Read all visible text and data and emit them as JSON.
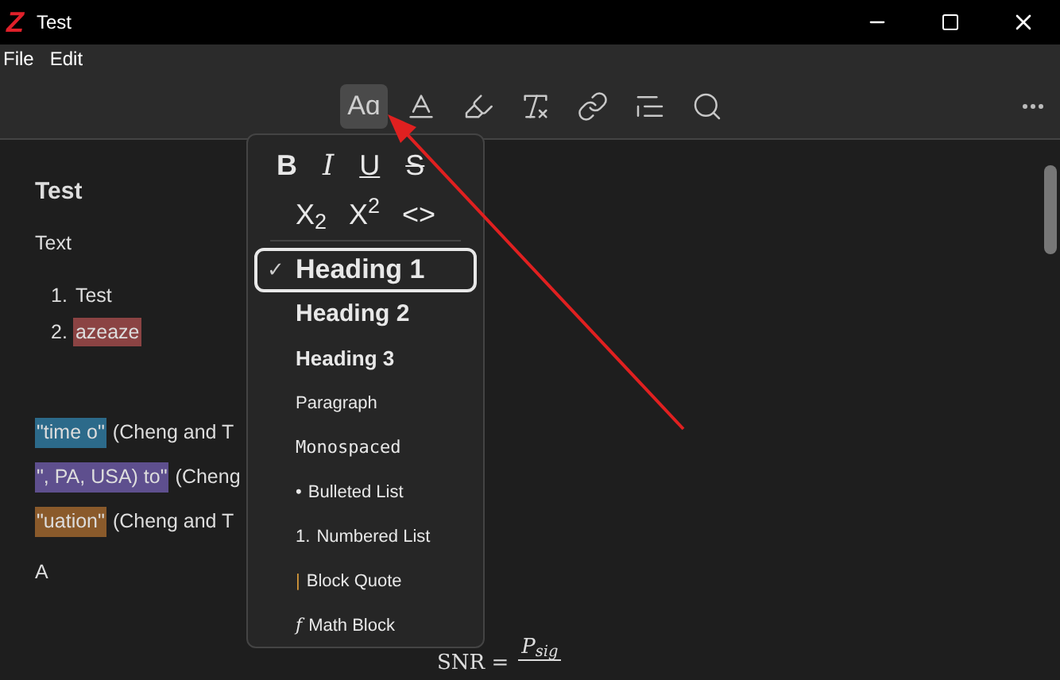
{
  "window": {
    "logo": "Z",
    "title": "Test"
  },
  "menu": [
    "File",
    "Edit"
  ],
  "toolbar": [
    {
      "kind": "text-style",
      "label": "Aɑ",
      "selected": true
    },
    {
      "kind": "text-color",
      "selected": false
    },
    {
      "kind": "highlight",
      "selected": false
    },
    {
      "kind": "clear-format",
      "selected": false
    },
    {
      "kind": "link",
      "selected": false
    },
    {
      "kind": "citation",
      "selected": false
    },
    {
      "kind": "search",
      "selected": false
    }
  ],
  "document": {
    "title": "Test",
    "paragraph": "Text",
    "list": [
      {
        "number": "1.",
        "text": "Test"
      },
      {
        "number": "2.",
        "text": "azeaze",
        "color": "#8b4343"
      }
    ],
    "annotations": [
      {
        "quote": "\"time o\"",
        "after": "(Cheng and T",
        "color": "#2c6a8a"
      },
      {
        "quote": "\", PA, USA) to\"",
        "after": "(Cheng",
        "color": "#5e4f8e"
      },
      {
        "quote": "\"uation\"",
        "after": "(Cheng and T",
        "color": "#8a5a2b"
      }
    ],
    "last_line": "A",
    "math": {
      "lhs": "SNR =",
      "numerator": "P$_{sig}$"
    }
  },
  "format_menu": {
    "check": "✓",
    "marks": [
      "B",
      "I",
      "U",
      "S"
    ],
    "marks2": [
      "X$_{2}$",
      "X$^{2}$",
      "<>"
    ],
    "blocks": [
      {
        "kind": "h1",
        "label": "Heading 1",
        "selected": true
      },
      {
        "kind": "h2",
        "label": "Heading 2",
        "selected": false
      },
      {
        "kind": "h3",
        "label": "Heading 3",
        "selected": false
      },
      {
        "kind": "p",
        "label": "Paragraph",
        "selected": false
      },
      {
        "kind": "mono",
        "label": "Monospaced",
        "selected": false
      },
      {
        "kind": "bullet",
        "prefix": "•",
        "label": "Bulleted List",
        "selected": false
      },
      {
        "kind": "number",
        "prefix": "1.",
        "label": "Numbered List",
        "selected": false
      },
      {
        "kind": "quote",
        "prefix": "|",
        "label": "Block Quote",
        "selected": false
      },
      {
        "kind": "math",
        "prefix": "f",
        "label": "Math Block",
        "selected": false
      }
    ]
  }
}
